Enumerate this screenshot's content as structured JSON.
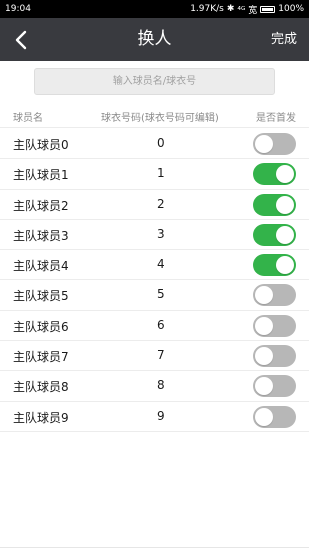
{
  "status_bar": {
    "time": "19:04",
    "speed": "1.97K/s",
    "signal": "⁴ᴳ 宽",
    "battery": "100%"
  },
  "nav": {
    "back_icon": "chevron-left-icon",
    "title": "换人",
    "done_label": "完成",
    "background": "#393a3f"
  },
  "search": {
    "placeholder": "输入球员名/球衣号",
    "value": ""
  },
  "table": {
    "headers": {
      "name": "球员名",
      "number": "球衣号码(球衣号码可编辑)",
      "starter": "是否首发"
    },
    "rows": [
      {
        "name": "主队球员0",
        "number": "0",
        "starter": false
      },
      {
        "name": "主队球员1",
        "number": "1",
        "starter": true
      },
      {
        "name": "主队球员2",
        "number": "2",
        "starter": true
      },
      {
        "name": "主队球员3",
        "number": "3",
        "starter": true
      },
      {
        "name": "主队球员4",
        "number": "4",
        "starter": true
      },
      {
        "name": "主队球员5",
        "number": "5",
        "starter": false
      },
      {
        "name": "主队球员6",
        "number": "6",
        "starter": false
      },
      {
        "name": "主队球员7",
        "number": "7",
        "starter": false
      },
      {
        "name": "主队球员8",
        "number": "8",
        "starter": false
      },
      {
        "name": "主队球员9",
        "number": "9",
        "starter": false
      }
    ]
  },
  "colors": {
    "toggle_on": "#33b34a",
    "toggle_off": "#b7b7b7"
  }
}
